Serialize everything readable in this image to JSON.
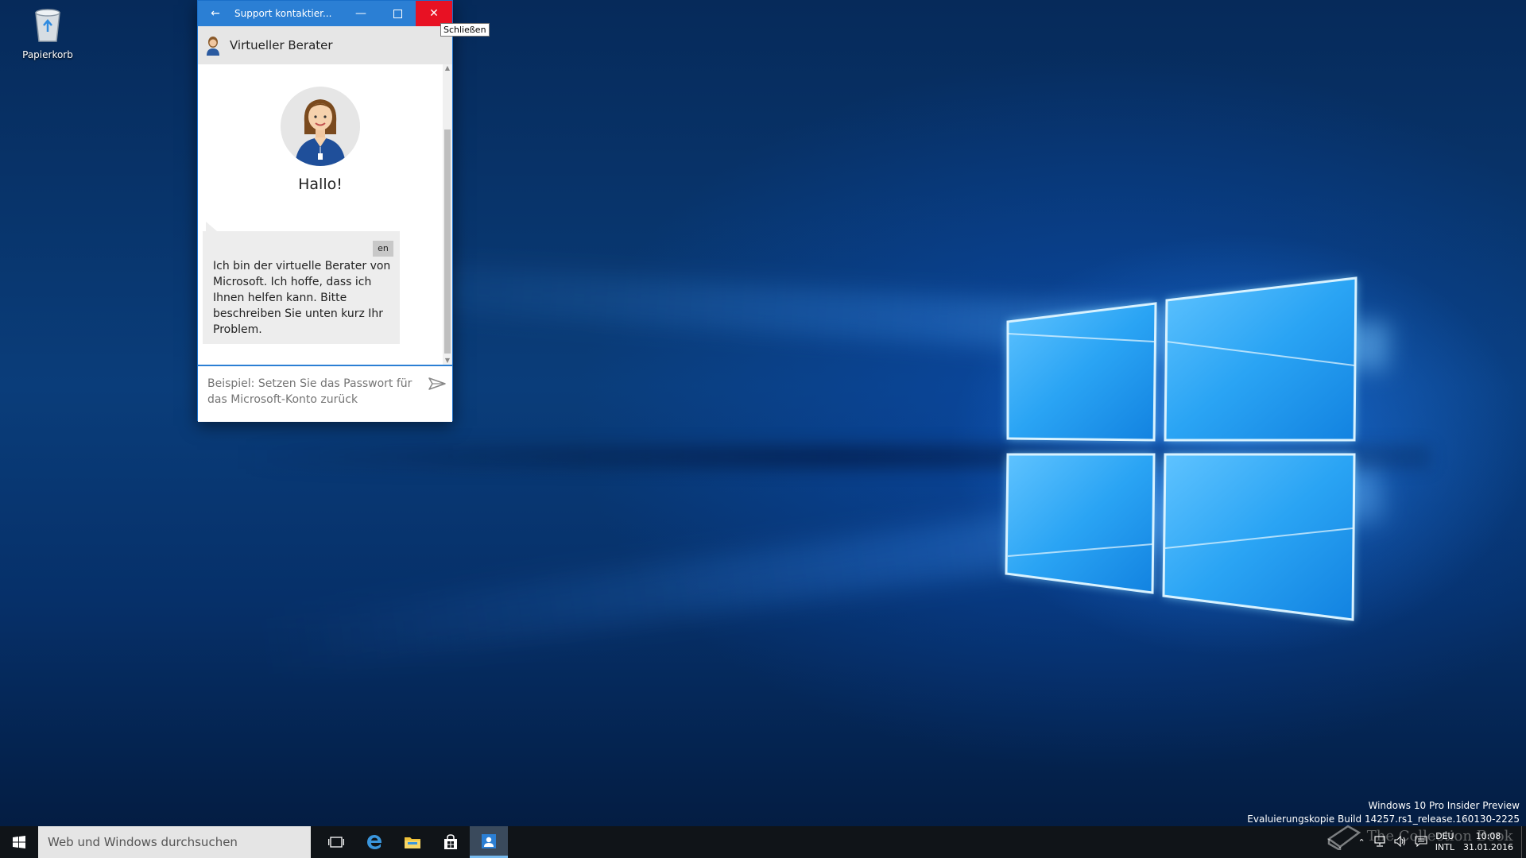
{
  "desktop": {
    "recycle_bin_label": "Papierkorb",
    "watermark": {
      "line1": "Windows 10 Pro Insider Preview",
      "line2": "Evaluierungskopie Build 14257.rs1_release.160130-2225"
    },
    "overlay_text": "The Collection Book"
  },
  "window": {
    "title": "Support kontaktier...",
    "close_tooltip": "Schließen",
    "agent_name": "Virtueller Berater",
    "greeting": "Hallo!",
    "message": {
      "lang": "en",
      "text": "Ich bin der virtuelle Berater von Microsoft. Ich hoffe, dass ich Ihnen helfen kann. Bitte beschreiben Sie unten kurz Ihr Problem."
    },
    "input_placeholder": "Beispiel: Setzen Sie das Passwort für das Microsoft-Konto zurück"
  },
  "taskbar": {
    "search_placeholder": "Web und Windows durchsuchen",
    "lang_top": "DEU",
    "lang_bottom": "INTL",
    "time": "10:08",
    "date": "31.01.2016"
  },
  "colors": {
    "titlebar": "#2b7fd4",
    "close_hover": "#e81123",
    "taskbar": "#101418"
  }
}
